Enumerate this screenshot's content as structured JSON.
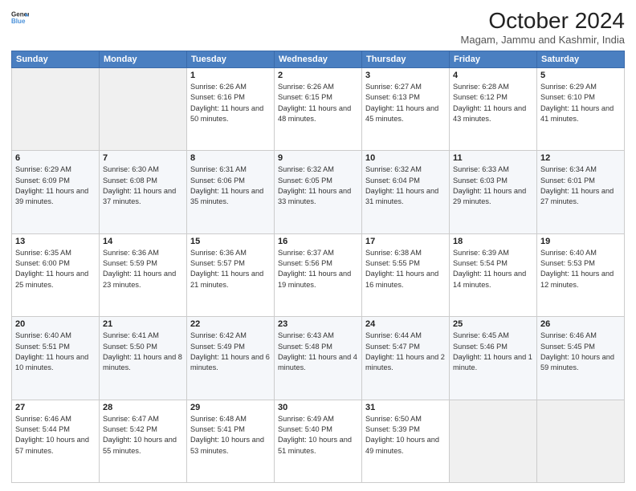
{
  "header": {
    "logo_line1": "General",
    "logo_line2": "Blue",
    "month_title": "October 2024",
    "location": "Magam, Jammu and Kashmir, India"
  },
  "days_of_week": [
    "Sunday",
    "Monday",
    "Tuesday",
    "Wednesday",
    "Thursday",
    "Friday",
    "Saturday"
  ],
  "weeks": [
    [
      {
        "day": "",
        "empty": true
      },
      {
        "day": "",
        "empty": true
      },
      {
        "day": "1",
        "sunrise": "Sunrise: 6:26 AM",
        "sunset": "Sunset: 6:16 PM",
        "daylight": "Daylight: 11 hours and 50 minutes."
      },
      {
        "day": "2",
        "sunrise": "Sunrise: 6:26 AM",
        "sunset": "Sunset: 6:15 PM",
        "daylight": "Daylight: 11 hours and 48 minutes."
      },
      {
        "day": "3",
        "sunrise": "Sunrise: 6:27 AM",
        "sunset": "Sunset: 6:13 PM",
        "daylight": "Daylight: 11 hours and 45 minutes."
      },
      {
        "day": "4",
        "sunrise": "Sunrise: 6:28 AM",
        "sunset": "Sunset: 6:12 PM",
        "daylight": "Daylight: 11 hours and 43 minutes."
      },
      {
        "day": "5",
        "sunrise": "Sunrise: 6:29 AM",
        "sunset": "Sunset: 6:10 PM",
        "daylight": "Daylight: 11 hours and 41 minutes."
      }
    ],
    [
      {
        "day": "6",
        "sunrise": "Sunrise: 6:29 AM",
        "sunset": "Sunset: 6:09 PM",
        "daylight": "Daylight: 11 hours and 39 minutes."
      },
      {
        "day": "7",
        "sunrise": "Sunrise: 6:30 AM",
        "sunset": "Sunset: 6:08 PM",
        "daylight": "Daylight: 11 hours and 37 minutes."
      },
      {
        "day": "8",
        "sunrise": "Sunrise: 6:31 AM",
        "sunset": "Sunset: 6:06 PM",
        "daylight": "Daylight: 11 hours and 35 minutes."
      },
      {
        "day": "9",
        "sunrise": "Sunrise: 6:32 AM",
        "sunset": "Sunset: 6:05 PM",
        "daylight": "Daylight: 11 hours and 33 minutes."
      },
      {
        "day": "10",
        "sunrise": "Sunrise: 6:32 AM",
        "sunset": "Sunset: 6:04 PM",
        "daylight": "Daylight: 11 hours and 31 minutes."
      },
      {
        "day": "11",
        "sunrise": "Sunrise: 6:33 AM",
        "sunset": "Sunset: 6:03 PM",
        "daylight": "Daylight: 11 hours and 29 minutes."
      },
      {
        "day": "12",
        "sunrise": "Sunrise: 6:34 AM",
        "sunset": "Sunset: 6:01 PM",
        "daylight": "Daylight: 11 hours and 27 minutes."
      }
    ],
    [
      {
        "day": "13",
        "sunrise": "Sunrise: 6:35 AM",
        "sunset": "Sunset: 6:00 PM",
        "daylight": "Daylight: 11 hours and 25 minutes."
      },
      {
        "day": "14",
        "sunrise": "Sunrise: 6:36 AM",
        "sunset": "Sunset: 5:59 PM",
        "daylight": "Daylight: 11 hours and 23 minutes."
      },
      {
        "day": "15",
        "sunrise": "Sunrise: 6:36 AM",
        "sunset": "Sunset: 5:57 PM",
        "daylight": "Daylight: 11 hours and 21 minutes."
      },
      {
        "day": "16",
        "sunrise": "Sunrise: 6:37 AM",
        "sunset": "Sunset: 5:56 PM",
        "daylight": "Daylight: 11 hours and 19 minutes."
      },
      {
        "day": "17",
        "sunrise": "Sunrise: 6:38 AM",
        "sunset": "Sunset: 5:55 PM",
        "daylight": "Daylight: 11 hours and 16 minutes."
      },
      {
        "day": "18",
        "sunrise": "Sunrise: 6:39 AM",
        "sunset": "Sunset: 5:54 PM",
        "daylight": "Daylight: 11 hours and 14 minutes."
      },
      {
        "day": "19",
        "sunrise": "Sunrise: 6:40 AM",
        "sunset": "Sunset: 5:53 PM",
        "daylight": "Daylight: 11 hours and 12 minutes."
      }
    ],
    [
      {
        "day": "20",
        "sunrise": "Sunrise: 6:40 AM",
        "sunset": "Sunset: 5:51 PM",
        "daylight": "Daylight: 11 hours and 10 minutes."
      },
      {
        "day": "21",
        "sunrise": "Sunrise: 6:41 AM",
        "sunset": "Sunset: 5:50 PM",
        "daylight": "Daylight: 11 hours and 8 minutes."
      },
      {
        "day": "22",
        "sunrise": "Sunrise: 6:42 AM",
        "sunset": "Sunset: 5:49 PM",
        "daylight": "Daylight: 11 hours and 6 minutes."
      },
      {
        "day": "23",
        "sunrise": "Sunrise: 6:43 AM",
        "sunset": "Sunset: 5:48 PM",
        "daylight": "Daylight: 11 hours and 4 minutes."
      },
      {
        "day": "24",
        "sunrise": "Sunrise: 6:44 AM",
        "sunset": "Sunset: 5:47 PM",
        "daylight": "Daylight: 11 hours and 2 minutes."
      },
      {
        "day": "25",
        "sunrise": "Sunrise: 6:45 AM",
        "sunset": "Sunset: 5:46 PM",
        "daylight": "Daylight: 11 hours and 1 minute."
      },
      {
        "day": "26",
        "sunrise": "Sunrise: 6:46 AM",
        "sunset": "Sunset: 5:45 PM",
        "daylight": "Daylight: 10 hours and 59 minutes."
      }
    ],
    [
      {
        "day": "27",
        "sunrise": "Sunrise: 6:46 AM",
        "sunset": "Sunset: 5:44 PM",
        "daylight": "Daylight: 10 hours and 57 minutes."
      },
      {
        "day": "28",
        "sunrise": "Sunrise: 6:47 AM",
        "sunset": "Sunset: 5:42 PM",
        "daylight": "Daylight: 10 hours and 55 minutes."
      },
      {
        "day": "29",
        "sunrise": "Sunrise: 6:48 AM",
        "sunset": "Sunset: 5:41 PM",
        "daylight": "Daylight: 10 hours and 53 minutes."
      },
      {
        "day": "30",
        "sunrise": "Sunrise: 6:49 AM",
        "sunset": "Sunset: 5:40 PM",
        "daylight": "Daylight: 10 hours and 51 minutes."
      },
      {
        "day": "31",
        "sunrise": "Sunrise: 6:50 AM",
        "sunset": "Sunset: 5:39 PM",
        "daylight": "Daylight: 10 hours and 49 minutes."
      },
      {
        "day": "",
        "empty": true
      },
      {
        "day": "",
        "empty": true
      }
    ]
  ]
}
